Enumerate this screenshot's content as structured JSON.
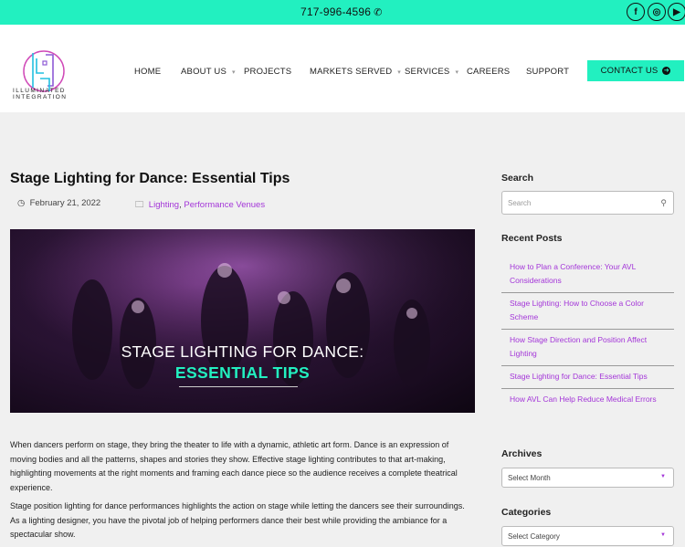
{
  "topbar": {
    "phone": "717-996-4596",
    "social": [
      {
        "name": "facebook",
        "glyph": "f"
      },
      {
        "name": "instagram",
        "glyph": "◎"
      },
      {
        "name": "youtube",
        "glyph": "▶"
      }
    ]
  },
  "brand": {
    "line1": "ILLUMINATED",
    "line2": "INTEGRATION"
  },
  "nav": {
    "home": "HOME",
    "about": "ABOUT US",
    "projects": "PROJECTS",
    "markets": "MARKETS SERVED",
    "services": "SERVICES",
    "careers": "CAREERS",
    "support": "SUPPORT",
    "contact": "CONTACT US"
  },
  "article": {
    "title": "Stage Lighting for Dance: Essential Tips",
    "date": "February 21, 2022",
    "cat1": "Lighting",
    "cat_sep": ", ",
    "cat2": "Performance Venues",
    "hero_line1": "STAGE LIGHTING FOR DANCE:",
    "hero_line2": "ESSENTIAL TIPS",
    "p1": "When dancers perform on stage, they bring the theater to life with a dynamic, athletic art form. Dance is an expression of moving bodies and all the patterns, shapes and stories they show. Effective stage lighting contributes to that art-making, highlighting movements at the right moments and framing each dance piece so the audience receives a complete theatrical experience.",
    "p2": "Stage position lighting for dance performances highlights the action on stage while letting the dancers see their surroundings. As a lighting designer, you have the pivotal job of helping performers dance their best while providing the ambiance for a spectacular show."
  },
  "sidebar": {
    "search_heading": "Search",
    "search_placeholder": "Search",
    "recent_heading": "Recent Posts",
    "posts": [
      "How to Plan a Conference: Your AVL Considerations",
      "Stage Lighting: How to Choose a Color Scheme",
      "How Stage Direction and Position Affect Lighting",
      "Stage Lighting for Dance: Essential Tips",
      "How AVL Can Help Reduce Medical Errors"
    ],
    "archives_heading": "Archives",
    "archives_select": "Select Month",
    "categories_heading": "Categories",
    "categories_select": "Select Category"
  },
  "colors": {
    "accent": "#22f0c0",
    "link": "#a335d8"
  }
}
